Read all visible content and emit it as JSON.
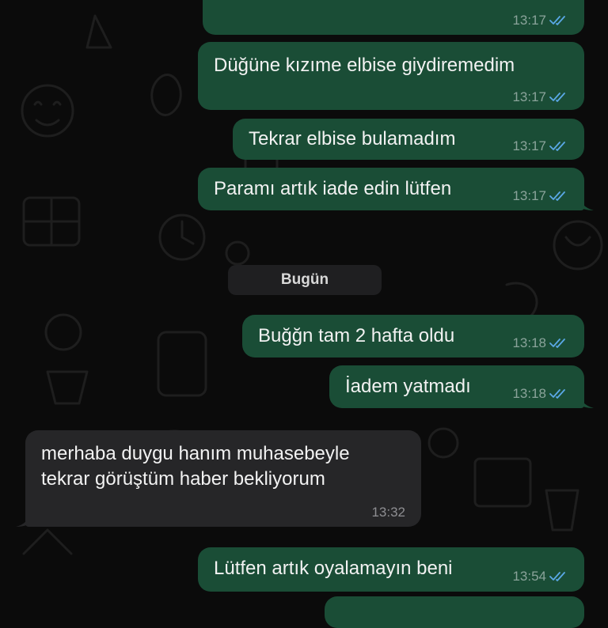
{
  "day_separator": "Bugün",
  "messages": [
    {
      "text": "",
      "time": "13:17",
      "dir": "out"
    },
    {
      "text": "Düğüne kızıme elbise giydiremedim",
      "time": "13:17",
      "dir": "out"
    },
    {
      "text": "Tekrar elbise bulamadım",
      "time": "13:17",
      "dir": "out"
    },
    {
      "text": "Paramı artık iade edin lütfen",
      "time": "13:17",
      "dir": "out"
    },
    {
      "text": "Buğğn tam 2 hafta oldu",
      "time": "13:18",
      "dir": "out"
    },
    {
      "text": "İadem yatmadı",
      "time": "13:18",
      "dir": "out"
    },
    {
      "lines": [
        "merhaba duygu hanım muhasebeyle",
        "tekrar görüştüm haber bekliyorum"
      ],
      "time": "13:32",
      "dir": "in"
    },
    {
      "text": "Lütfen artık oyalamayın beni",
      "time": "13:54",
      "dir": "out"
    }
  ],
  "colors": {
    "outgoing_bubble": "#1a4d36",
    "incoming_bubble": "#262628",
    "read_tick": "#5aa8e6",
    "background": "#0b0b0b"
  },
  "icons": {
    "read_receipt": "double-check-icon"
  }
}
